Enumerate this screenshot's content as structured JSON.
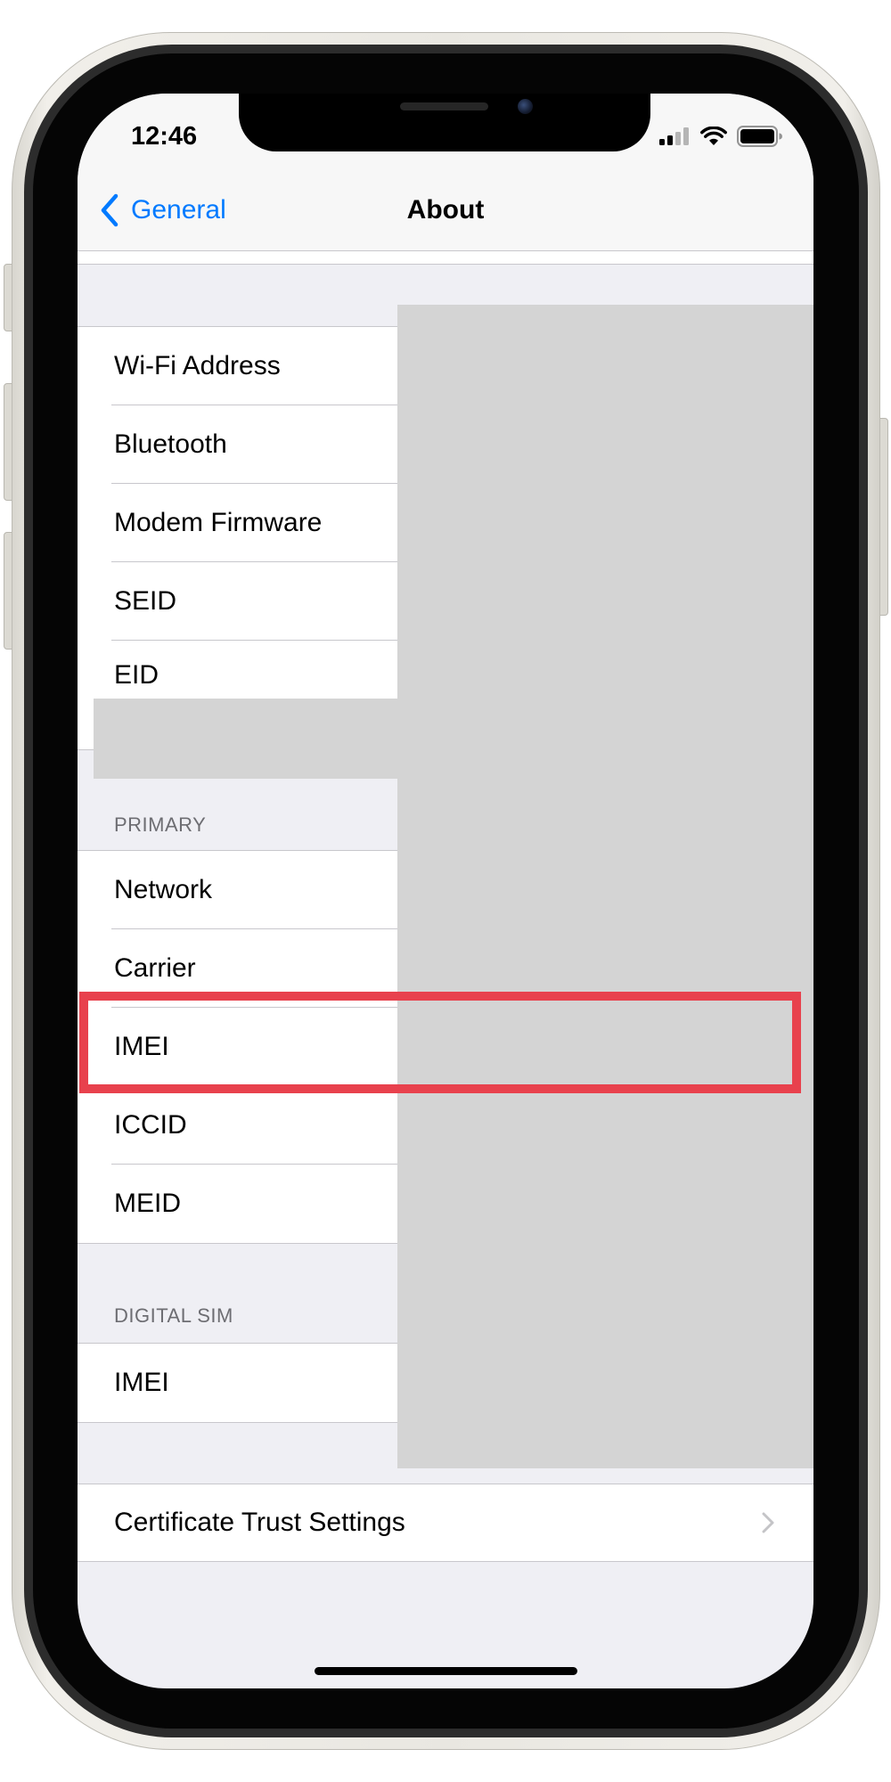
{
  "status_bar": {
    "time": "12:46",
    "icons": {
      "signal": "cellular-signal-icon",
      "wifi": "wifi-icon",
      "battery": "battery-icon"
    }
  },
  "nav": {
    "back_icon": "chevron-left-icon",
    "back_label": "General",
    "title": "About"
  },
  "sections": [
    {
      "rows": [
        {
          "label": "Wi-Fi Address"
        },
        {
          "label": "Bluetooth"
        },
        {
          "label": "Modem Firmware"
        },
        {
          "label": "SEID"
        },
        {
          "label": "EID"
        }
      ]
    },
    {
      "header": "PRIMARY",
      "rows": [
        {
          "label": "Network"
        },
        {
          "label": "Carrier"
        },
        {
          "label": "IMEI"
        },
        {
          "label": "ICCID"
        },
        {
          "label": "MEID"
        }
      ]
    },
    {
      "header": "DIGITAL SIM",
      "rows": [
        {
          "label": "IMEI"
        }
      ]
    },
    {
      "rows": [
        {
          "label": "Certificate Trust Settings",
          "icon": "chevron-right-icon"
        }
      ]
    }
  ],
  "colors": {
    "accent": "#007aff",
    "highlight": "#e8414d",
    "redaction": "#d4d4d4",
    "grouped_background": "#efeff4"
  }
}
